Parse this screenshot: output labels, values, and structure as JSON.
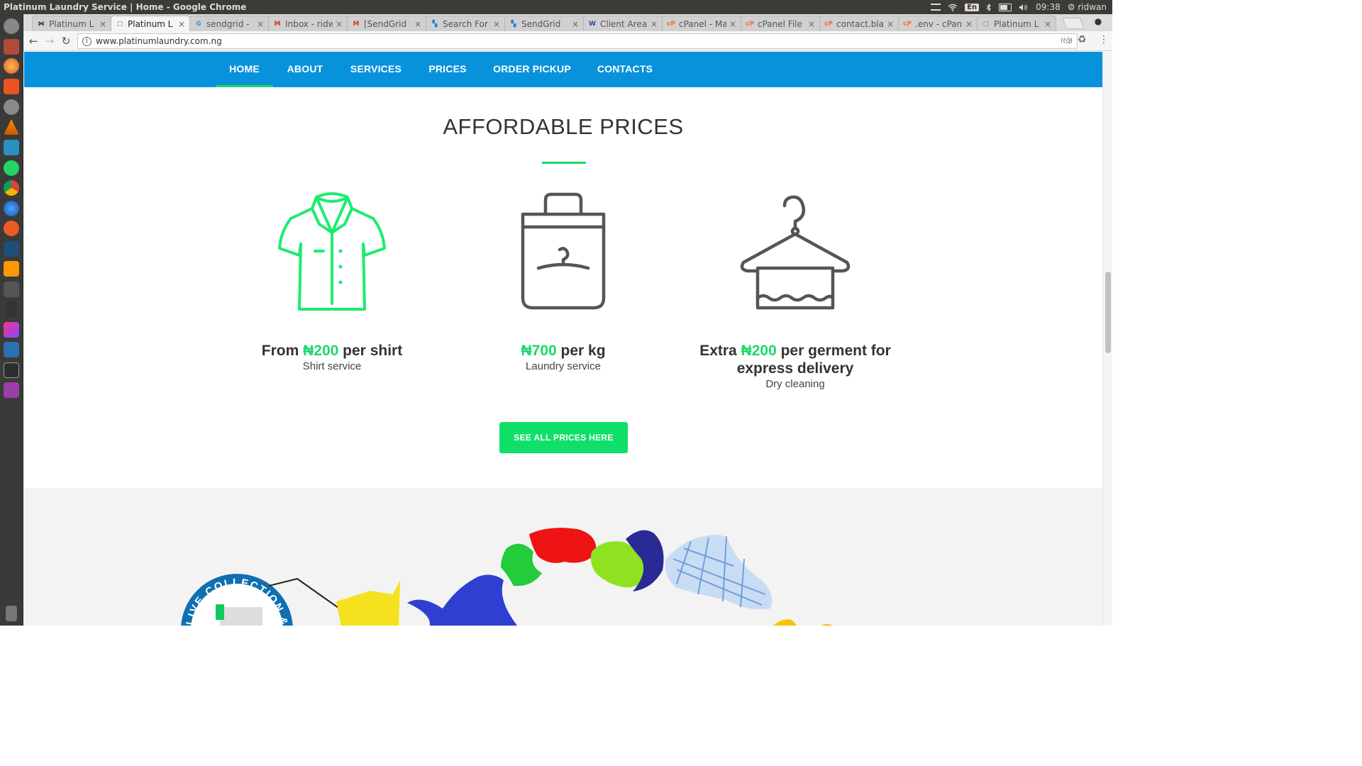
{
  "os": {
    "window_title": "Platinum Laundry Service | Home - Google Chrome",
    "lang": "En",
    "clock": "09:38",
    "user": "ridwan"
  },
  "browser": {
    "tabs": [
      {
        "label": "Platinum L",
        "fav": "mask-icon",
        "color": "#222222"
      },
      {
        "label": "Platinum L",
        "fav": "doc-icon",
        "color": "#777777"
      },
      {
        "label": "sendgrid -",
        "fav": "google-icon",
        "color": "#4285f4"
      },
      {
        "label": "Inbox - ridw",
        "fav": "gmail-icon",
        "color": "#d93025"
      },
      {
        "label": "[SendGrid",
        "fav": "gmail-icon",
        "color": "#d93025"
      },
      {
        "label": "Search For",
        "fav": "sendgrid-icon",
        "color": "#1a82e2"
      },
      {
        "label": "SendGrid",
        "fav": "sendgrid-icon",
        "color": "#1a82e2"
      },
      {
        "label": "Client Area",
        "fav": "whmcs-icon",
        "color": "#1b4f9c"
      },
      {
        "label": "cPanel - Ma",
        "fav": "cpanel-icon",
        "color": "#ff6c2c"
      },
      {
        "label": "cPanel File",
        "fav": "cpanel-icon",
        "color": "#ff6c2c"
      },
      {
        "label": "contact.bla",
        "fav": "cpanel-icon",
        "color": "#ff6c2c"
      },
      {
        "label": ".env - cPan",
        "fav": "cpanel-icon",
        "color": "#ff6c2c"
      },
      {
        "label": "Platinum L",
        "fav": "doc-icon",
        "color": "#777777"
      }
    ],
    "url": "www.platinumlaundry.com.ng"
  },
  "site": {
    "nav": [
      "HOME",
      "ABOUT",
      "SERVICES",
      "PRICES",
      "ORDER PICKUP",
      "CONTACTS"
    ],
    "active_nav": "HOME",
    "section_title": "AFFORDABLE PRICES",
    "cards": [
      {
        "icon": "shirt-icon",
        "prefix": "From ",
        "price": "₦200",
        "suffix": " per shirt",
        "sub": "Shirt service"
      },
      {
        "icon": "laundry-bag-icon",
        "prefix": "",
        "price": "₦700",
        "suffix": " per kg",
        "sub": "Laundry service"
      },
      {
        "icon": "towel-hanger-icon",
        "prefix": "Extra ",
        "price": "₦200",
        "suffix": " per germent for express delivery",
        "sub": "Dry cleaning"
      }
    ],
    "cta": "SEE ALL PRICES HERE",
    "badge_text": "LIVE COLLECTION &",
    "colors": {
      "nav_bg": "#0992dc",
      "accent": "#1dd86b",
      "icon_gray": "#555555"
    }
  }
}
